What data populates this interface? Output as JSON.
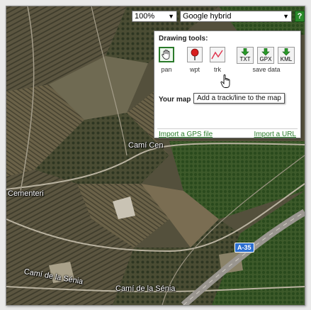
{
  "map_controls": {
    "zoom": {
      "value": "100%"
    },
    "map_type": {
      "value": "Google hybrid"
    },
    "help_label": "?"
  },
  "panel": {
    "title": "Drawing tools:",
    "tools": [
      {
        "label": "pan",
        "icon": "hand-icon",
        "active": true
      },
      {
        "label": "wpt",
        "icon": "map-pin-icon",
        "active": false
      },
      {
        "label": "trk",
        "icon": "track-line-icon",
        "active": false
      }
    ],
    "save_buttons": [
      {
        "label": "TXT",
        "icon": "download-arrow-icon"
      },
      {
        "label": "GPX",
        "icon": "download-arrow-icon"
      },
      {
        "label": "KML",
        "icon": "download-arrow-icon"
      }
    ],
    "save_caption": "save data",
    "your_map_label": "Your map",
    "import_gps": "Import a GPS file",
    "import_url": "Import a URL"
  },
  "tooltip": "Add a track/line to the map",
  "map_labels": {
    "cami_cen": "Camí Cen",
    "cementeri": "Cementeri",
    "cami_senia_1": "Camí de la Sénia",
    "cami_senia_2": "Camí de la Sénia",
    "highway": "A-35"
  },
  "colors": {
    "accent_green": "#2a8a2a",
    "link_green": "#2a7d2a",
    "pin_red": "#d81e1e",
    "shield_blue": "#2c6fd0"
  }
}
